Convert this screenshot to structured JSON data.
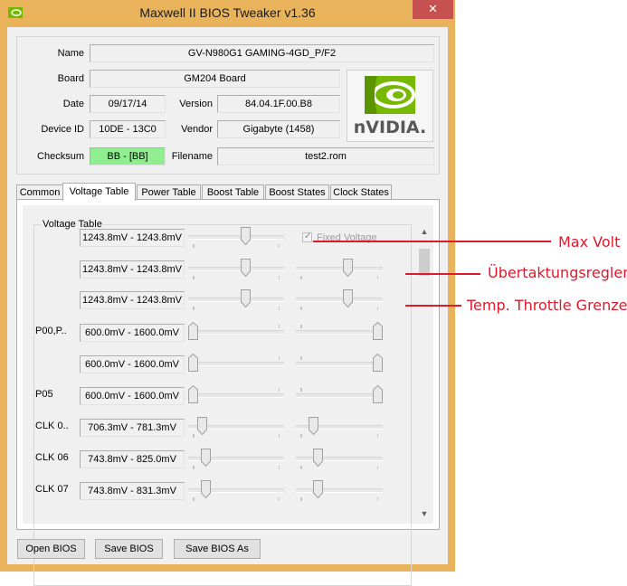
{
  "window": {
    "title": "Maxwell II BIOS Tweaker v1.36",
    "close_glyph": "✕"
  },
  "info": {
    "name_label": "Name",
    "name_value": "GV-N980G1 GAMING-4GD_P/F2",
    "board_label": "Board",
    "board_value": "GM204 Board",
    "date_label": "Date",
    "date_value": "09/17/14",
    "version_label": "Version",
    "version_value": "84.04.1F.00.B8",
    "device_label": "Device ID",
    "device_value": "10DE - 13C0",
    "vendor_label": "Vendor",
    "vendor_value": "Gigabyte (1458)",
    "checksum_label": "Checksum",
    "checksum_value": "BB - [BB]",
    "filename_label": "Filename",
    "filename_value": "test2.rom",
    "logo_text": "nVIDIA.",
    "checksum_color": "#90ee90"
  },
  "tabs": [
    {
      "label": "Common"
    },
    {
      "label": "Voltage Table"
    },
    {
      "label": "Power Table"
    },
    {
      "label": "Boost Table"
    },
    {
      "label": "Boost States"
    },
    {
      "label": "Clock States"
    }
  ],
  "voltage_table": {
    "group_title": "Voltage Table",
    "fixed_voltage_label": "Fixed Voltage",
    "rows": [
      {
        "label": "",
        "range": "1243.8mV - 1243.8mV",
        "slider_a": 0.61,
        "slider_b": null
      },
      {
        "label": "",
        "range": "1243.8mV - 1243.8mV",
        "slider_a": 0.61,
        "slider_b": 0.61
      },
      {
        "label": "",
        "range": "1243.8mV - 1243.8mV",
        "slider_a": 0.61,
        "slider_b": 0.61
      },
      {
        "label": "P00,P..",
        "range": "600.0mV - 1600.0mV",
        "slider_a": 0.0,
        "slider_b": 1.0
      },
      {
        "label": "",
        "range": "600.0mV - 1600.0mV",
        "slider_a": 0.0,
        "slider_b": 1.0
      },
      {
        "label": "P05",
        "range": "600.0mV - 1600.0mV",
        "slider_a": 0.0,
        "slider_b": 1.0
      },
      {
        "label": "CLK 0..",
        "range": "706.3mV - 781.3mV",
        "slider_a": 0.1,
        "slider_b": 0.17
      },
      {
        "label": "CLK 06",
        "range": "743.8mV - 825.0mV",
        "slider_a": 0.15,
        "slider_b": 0.22
      },
      {
        "label": "CLK 07",
        "range": "743.8mV - 831.3mV",
        "slider_a": 0.15,
        "slider_b": 0.22
      }
    ]
  },
  "scrollbar": {
    "up_glyph": "▲",
    "down_glyph": "▼"
  },
  "buttons": {
    "open": "Open BIOS",
    "save": "Save BIOS",
    "save_as": "Save BIOS As"
  },
  "annotations": [
    {
      "text": "Max Volt"
    },
    {
      "text": "Übertaktungsregler"
    },
    {
      "text": "Temp. Throttle Grenze"
    }
  ],
  "colors": {
    "frame": "#e8b35a",
    "close": "#c75050",
    "annotation": "#e0182c",
    "nvidia_green": "#76b900"
  }
}
